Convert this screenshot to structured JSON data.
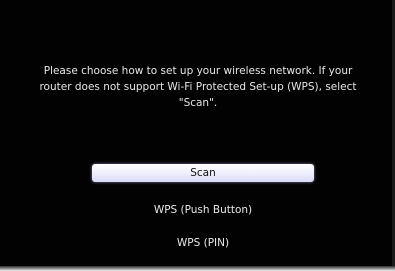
{
  "setup": {
    "message": "Please choose how to set up your wireless network. If your\nrouter does not support Wi-Fi Protected Set-up (WPS), select\n\"Scan\".",
    "options": [
      {
        "label": "Scan",
        "selected": true
      },
      {
        "label": "WPS (Push Button)",
        "selected": false
      },
      {
        "label": "WPS (PIN)",
        "selected": false
      }
    ]
  },
  "colors": {
    "background": "#020202",
    "text": "#e6e6e6",
    "highlight": "#f1f1ff"
  }
}
